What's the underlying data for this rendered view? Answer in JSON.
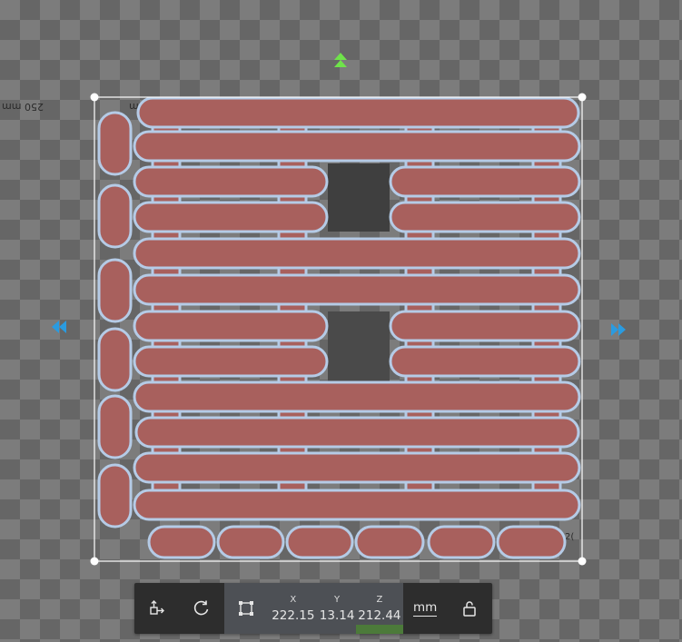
{
  "viewport": {
    "ruler_left_label": "250 mm",
    "ruler_top_label": "mm",
    "ruler_bottom_label": "2("
  },
  "model": {
    "fill_color": "#a8605d",
    "outline_color": "#b5cbe6",
    "selection_color": "#ffffff"
  },
  "handles": {
    "up_color": "#6fe34a",
    "side_color": "#2a9be0"
  },
  "toolbar": {
    "move_icon": "move-axis-icon",
    "rotate_icon": "rotate-icon",
    "scale_icon": "scale-frame-icon",
    "x_label": "X",
    "x_value": "222.15",
    "y_label": "Y",
    "y_value": "13.14",
    "z_label": "Z",
    "z_value": "212.44",
    "unit": "mm",
    "lock_icon": "unlock-icon"
  }
}
